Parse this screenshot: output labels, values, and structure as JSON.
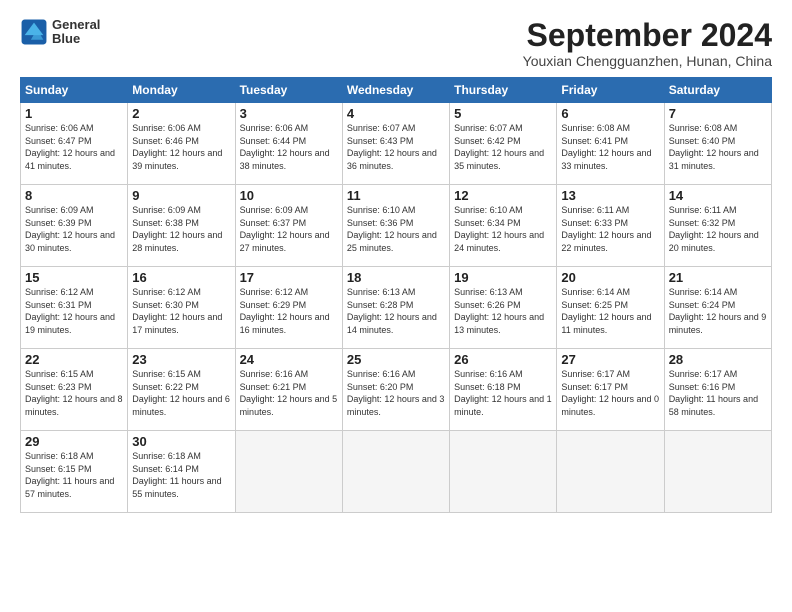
{
  "header": {
    "logo_line1": "General",
    "logo_line2": "Blue",
    "month_year": "September 2024",
    "location": "Youxian Chengguanzhen, Hunan, China"
  },
  "days_of_week": [
    "Sunday",
    "Monday",
    "Tuesday",
    "Wednesday",
    "Thursday",
    "Friday",
    "Saturday"
  ],
  "weeks": [
    [
      {
        "day": "1",
        "sunrise": "6:06 AM",
        "sunset": "6:47 PM",
        "daylight": "12 hours and 41 minutes"
      },
      {
        "day": "2",
        "sunrise": "6:06 AM",
        "sunset": "6:46 PM",
        "daylight": "12 hours and 39 minutes"
      },
      {
        "day": "3",
        "sunrise": "6:06 AM",
        "sunset": "6:44 PM",
        "daylight": "12 hours and 38 minutes"
      },
      {
        "day": "4",
        "sunrise": "6:07 AM",
        "sunset": "6:43 PM",
        "daylight": "12 hours and 36 minutes"
      },
      {
        "day": "5",
        "sunrise": "6:07 AM",
        "sunset": "6:42 PM",
        "daylight": "12 hours and 35 minutes"
      },
      {
        "day": "6",
        "sunrise": "6:08 AM",
        "sunset": "6:41 PM",
        "daylight": "12 hours and 33 minutes"
      },
      {
        "day": "7",
        "sunrise": "6:08 AM",
        "sunset": "6:40 PM",
        "daylight": "12 hours and 31 minutes"
      }
    ],
    [
      {
        "day": "8",
        "sunrise": "6:09 AM",
        "sunset": "6:39 PM",
        "daylight": "12 hours and 30 minutes"
      },
      {
        "day": "9",
        "sunrise": "6:09 AM",
        "sunset": "6:38 PM",
        "daylight": "12 hours and 28 minutes"
      },
      {
        "day": "10",
        "sunrise": "6:09 AM",
        "sunset": "6:37 PM",
        "daylight": "12 hours and 27 minutes"
      },
      {
        "day": "11",
        "sunrise": "6:10 AM",
        "sunset": "6:36 PM",
        "daylight": "12 hours and 25 minutes"
      },
      {
        "day": "12",
        "sunrise": "6:10 AM",
        "sunset": "6:34 PM",
        "daylight": "12 hours and 24 minutes"
      },
      {
        "day": "13",
        "sunrise": "6:11 AM",
        "sunset": "6:33 PM",
        "daylight": "12 hours and 22 minutes"
      },
      {
        "day": "14",
        "sunrise": "6:11 AM",
        "sunset": "6:32 PM",
        "daylight": "12 hours and 20 minutes"
      }
    ],
    [
      {
        "day": "15",
        "sunrise": "6:12 AM",
        "sunset": "6:31 PM",
        "daylight": "12 hours and 19 minutes"
      },
      {
        "day": "16",
        "sunrise": "6:12 AM",
        "sunset": "6:30 PM",
        "daylight": "12 hours and 17 minutes"
      },
      {
        "day": "17",
        "sunrise": "6:12 AM",
        "sunset": "6:29 PM",
        "daylight": "12 hours and 16 minutes"
      },
      {
        "day": "18",
        "sunrise": "6:13 AM",
        "sunset": "6:28 PM",
        "daylight": "12 hours and 14 minutes"
      },
      {
        "day": "19",
        "sunrise": "6:13 AM",
        "sunset": "6:26 PM",
        "daylight": "12 hours and 13 minutes"
      },
      {
        "day": "20",
        "sunrise": "6:14 AM",
        "sunset": "6:25 PM",
        "daylight": "12 hours and 11 minutes"
      },
      {
        "day": "21",
        "sunrise": "6:14 AM",
        "sunset": "6:24 PM",
        "daylight": "12 hours and 9 minutes"
      }
    ],
    [
      {
        "day": "22",
        "sunrise": "6:15 AM",
        "sunset": "6:23 PM",
        "daylight": "12 hours and 8 minutes"
      },
      {
        "day": "23",
        "sunrise": "6:15 AM",
        "sunset": "6:22 PM",
        "daylight": "12 hours and 6 minutes"
      },
      {
        "day": "24",
        "sunrise": "6:16 AM",
        "sunset": "6:21 PM",
        "daylight": "12 hours and 5 minutes"
      },
      {
        "day": "25",
        "sunrise": "6:16 AM",
        "sunset": "6:20 PM",
        "daylight": "12 hours and 3 minutes"
      },
      {
        "day": "26",
        "sunrise": "6:16 AM",
        "sunset": "6:18 PM",
        "daylight": "12 hours and 1 minute"
      },
      {
        "day": "27",
        "sunrise": "6:17 AM",
        "sunset": "6:17 PM",
        "daylight": "12 hours and 0 minutes"
      },
      {
        "day": "28",
        "sunrise": "6:17 AM",
        "sunset": "6:16 PM",
        "daylight": "11 hours and 58 minutes"
      }
    ],
    [
      {
        "day": "29",
        "sunrise": "6:18 AM",
        "sunset": "6:15 PM",
        "daylight": "11 hours and 57 minutes"
      },
      {
        "day": "30",
        "sunrise": "6:18 AM",
        "sunset": "6:14 PM",
        "daylight": "11 hours and 55 minutes"
      },
      null,
      null,
      null,
      null,
      null
    ]
  ]
}
